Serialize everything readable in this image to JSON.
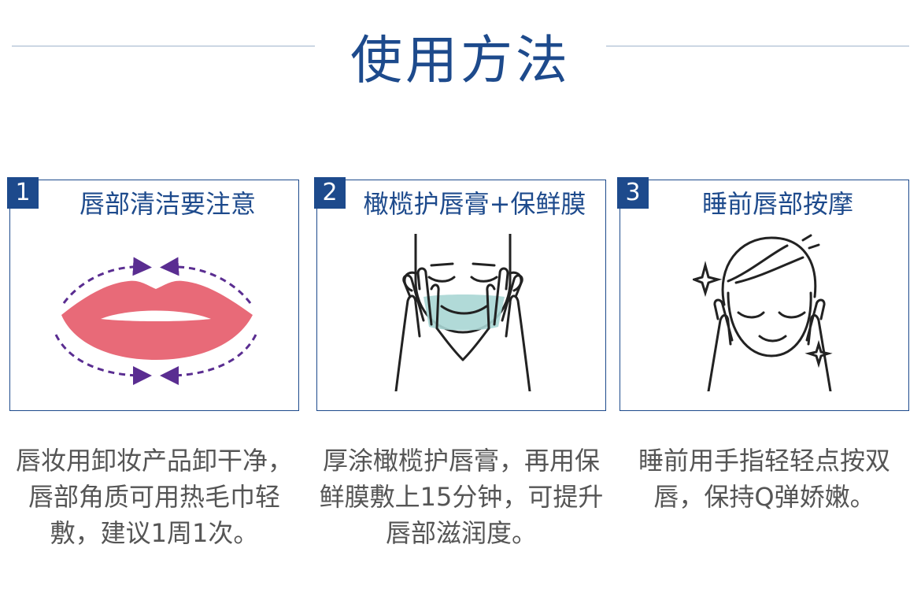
{
  "title": "使用方法",
  "steps": [
    {
      "number": "1",
      "heading": "唇部清洁要注意",
      "description": "唇妆用卸妆产品卸干净，唇部角质可用热毛巾轻敷，建议1周1次。",
      "illustration": "lips-arrows-illustration"
    },
    {
      "number": "2",
      "heading": "橄榄护唇膏+保鲜膜",
      "description": "厚涂橄榄护唇膏，再用保鲜膜敷上15分钟，可提升唇部滋润度。",
      "illustration": "man-lip-wrap-illustration"
    },
    {
      "number": "3",
      "heading": "睡前唇部按摩",
      "description": "睡前用手指轻轻点按双唇，保持Q弹娇嫩。",
      "illustration": "woman-massage-illustration"
    }
  ],
  "colors": {
    "accent": "#1d4a8c",
    "lips": "#e86a78",
    "arrows": "#5a2d91",
    "wrap": "#a9d6d4",
    "text": "#555555"
  }
}
